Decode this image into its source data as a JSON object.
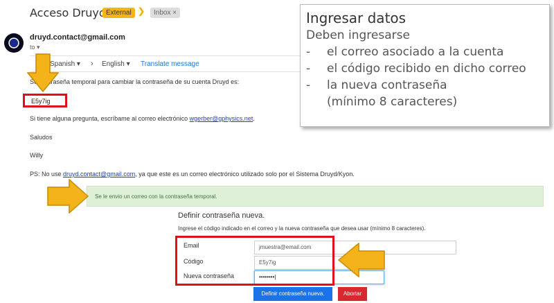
{
  "email": {
    "subject": "Acceso Druyd",
    "badge_external": "External",
    "badge_inbox": "Inbox ×",
    "sender": "druyd.contact@gmail.com",
    "to": "to ▾"
  },
  "translate": {
    "from": "Spanish ▾",
    "arrow": "›",
    "to": "English ▾",
    "link": "Translate message"
  },
  "body": {
    "line1": "Su contraseña temporal para cambiar la contraseña de su cuenta Druyd es:",
    "code": "E5y7ig",
    "question_prefix": "Si tiene alguna pregunta, escríbame al correo electrónico ",
    "question_link": "wgerber@gphysics.net",
    "question_suffix": ".",
    "saludos": "Saludos",
    "signature": "Willy",
    "ps_prefix": "PS: No use ",
    "ps_link": "druyd.contact@gmail.com",
    "ps_suffix": ", ya que este es un correo electrónico utilizado solo por el Sistema Druyd/Kyon."
  },
  "alert": {
    "text": "Se le envio un correo con la contraseña temporal."
  },
  "form": {
    "title": "Definir contraseña nueva.",
    "instructions": "Ingrese el código indicado en el correo y la nueva contraseña que desea usar (mínimo 8 caracteres).",
    "email_label": "Email",
    "email_value": "jmuestra@email.com",
    "code_label": "Código",
    "code_value": "E5y7ig",
    "password_label": "Nueva contraseña",
    "password_value": "••••••••|",
    "submit_label": "Definir contraseña nueva.",
    "cancel_label": "Abortar"
  },
  "info_panel": {
    "title": "Ingresar datos",
    "subtitle": "Deben ingresarse",
    "items": [
      "el correo asociado a la cuenta",
      "el código recibido en dicho correo",
      "la nueva contraseña",
      "(mínimo 8 caracteres)"
    ],
    "dash": "-"
  },
  "colors": {
    "arrow_fill": "#f5b31a",
    "arrow_stroke": "#c98a00",
    "highlight_red": "#e0101a",
    "alert_bg": "#dff0d8",
    "primary": "#1a73e8",
    "danger": "#d9282f"
  }
}
